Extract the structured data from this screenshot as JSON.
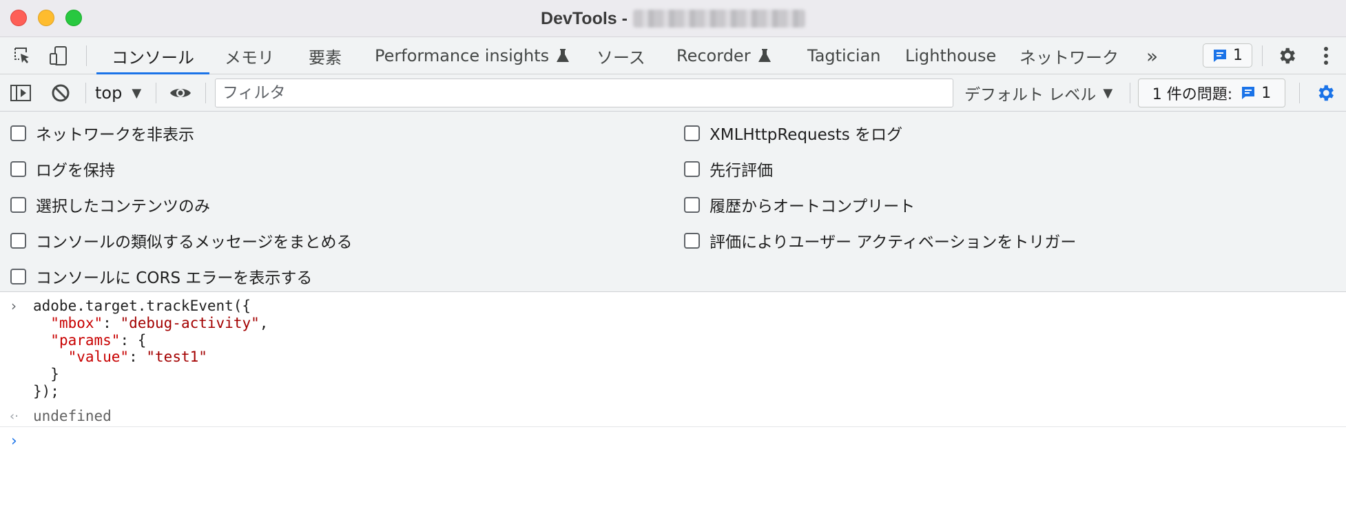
{
  "window": {
    "title": "DevTools - "
  },
  "tabs": [
    {
      "label": "コンソール",
      "active": true
    },
    {
      "label": "メモリ"
    },
    {
      "label": "要素"
    },
    {
      "label": "Performance insights",
      "experimental": true
    },
    {
      "label": "ソース"
    },
    {
      "label": "Recorder",
      "experimental": true
    },
    {
      "label": "Tagtician"
    },
    {
      "label": "Lighthouse"
    },
    {
      "label": "ネットワーク"
    }
  ],
  "tabbar": {
    "more_tabs_glyph": "»",
    "issue_count": "1"
  },
  "toolbar": {
    "context": "top",
    "filter_placeholder": "フィルタ",
    "level": "デフォルト レベル",
    "issues_label": "1 件の問題:",
    "issues_count": "1"
  },
  "settings": {
    "left": [
      {
        "label": "ネットワークを非表示",
        "checked": false
      },
      {
        "label": "ログを保持",
        "checked": false
      },
      {
        "label": "選択したコンテンツのみ",
        "checked": false
      },
      {
        "label": "コンソールの類似するメッセージをまとめる",
        "checked": false
      },
      {
        "label": "コンソールに CORS エラーを表示する",
        "checked": false
      }
    ],
    "right": [
      {
        "label": "XMLHttpRequests をログ",
        "checked": false
      },
      {
        "label": "先行評価",
        "checked": false
      },
      {
        "label": "履歴からオートコンプリート",
        "checked": false
      },
      {
        "label": "評価によりユーザー アクティベーションをトリガー",
        "checked": false
      }
    ]
  },
  "console": {
    "input": {
      "line1": "adobe.target.trackEvent({",
      "mbox_key": "\"mbox\"",
      "mbox_value": "\"debug-activity\"",
      "params_key": "\"params\"",
      "value_key": "\"value\"",
      "value_value": "\"test1\"",
      "close_inner": "}",
      "close_outer": "});"
    },
    "result": "undefined"
  },
  "colors": {
    "accent": "#1a73e8",
    "string": "#a30000",
    "key": "#c80000",
    "close": "#fe5f57",
    "minimize": "#febc2e",
    "maximize": "#28c840"
  }
}
